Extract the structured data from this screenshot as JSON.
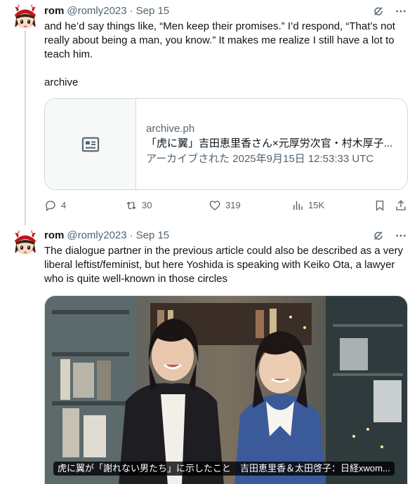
{
  "tweets": [
    {
      "name": "rom",
      "handle": "@romly2023",
      "separator": "·",
      "date": "Sep 15",
      "text": "and he’d say things like, “Men keep their promises.” I’d respond, “That’s not really about being a man, you know.” It makes me realize I still have a lot to teach him.",
      "link_text": "archive",
      "card": {
        "domain": "archive.ph",
        "title": "「虎に翼」吉田恵里香さん×元厚労次官・村木厚子...",
        "description": "アーカイブされた 2025年9月15日 12:53:33 UTC",
        "thumb_icon": "article-icon"
      },
      "actions": {
        "replies": "4",
        "reposts": "30",
        "likes": "319",
        "views": "15K"
      }
    },
    {
      "name": "rom",
      "handle": "@romly2023",
      "separator": "·",
      "date": "Sep 15",
      "text": "The dialogue partner in the previous article could also be described as a very liberal leftist/feminist, but here Yoshida is speaking with Keiko Ota, a lawyer who is quite well-known in those circles",
      "media_caption": "虎に翼が「謝れない男たち」に示したこと　吉田恵里香＆太田啓子：日経xwom..."
    }
  ],
  "colors": {
    "text_primary": "#0f1419",
    "text_secondary": "#536471",
    "border": "#cfd9de"
  }
}
